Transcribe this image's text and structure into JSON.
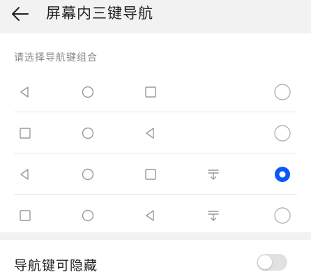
{
  "header": {
    "back_icon": "arrow-left-icon",
    "title": "屏幕内三键导航"
  },
  "hint": "请选择导航键组合",
  "combinations": [
    {
      "keys": [
        "back",
        "home",
        "recent"
      ],
      "selected": false
    },
    {
      "keys": [
        "recent",
        "home",
        "back"
      ],
      "selected": false
    },
    {
      "keys": [
        "back",
        "home",
        "recent",
        "notification"
      ],
      "selected": true
    },
    {
      "keys": [
        "recent",
        "home",
        "back",
        "notification"
      ],
      "selected": false
    }
  ],
  "footer": {
    "label": "导航键可隐藏",
    "toggle_on": false
  },
  "colors": {
    "accent": "#0a59f7",
    "icon": "#999999",
    "radio_outline": "#b3b3b3"
  }
}
